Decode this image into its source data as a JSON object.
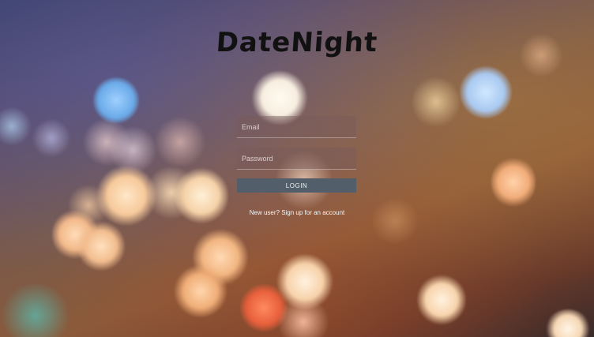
{
  "app": {
    "logo_text": "DateNight"
  },
  "login_form": {
    "email_placeholder": "Email",
    "password_placeholder": "Password",
    "login_label": "LOGIN",
    "signup_link": "New user? Sign up for an account"
  }
}
